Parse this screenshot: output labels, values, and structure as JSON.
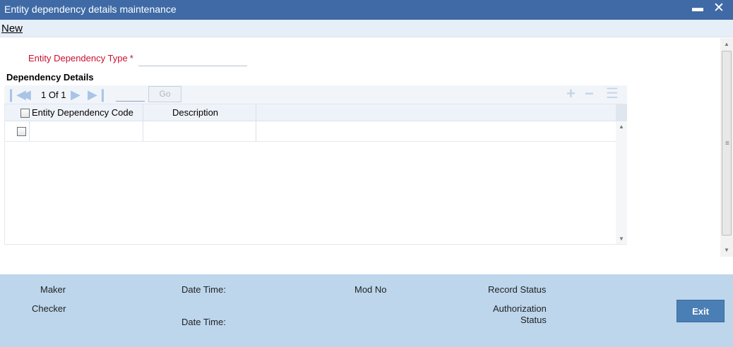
{
  "window": {
    "title": "Entity dependency details maintenance",
    "minimize_glyph": "▬",
    "close_glyph": "✕"
  },
  "menubar": {
    "new_label": "New"
  },
  "form": {
    "entity_dependency_type_label": "Entity Dependency Type",
    "required_mark": "*",
    "entity_dependency_type_value": ""
  },
  "section": {
    "title": "Dependency Details"
  },
  "pager": {
    "current": "1",
    "of_label": "Of",
    "total": "1",
    "go_label": "Go",
    "page_input_value": ""
  },
  "grid": {
    "columns": [
      "Entity Dependency Code",
      "Description"
    ],
    "rows": [
      {
        "code": "",
        "description": ""
      }
    ]
  },
  "footer": {
    "maker_label": "Maker",
    "checker_label": "Checker",
    "date_time_label_1": "Date Time:",
    "date_time_label_2": "Date Time:",
    "mod_no_label": "Mod No",
    "record_status_label": "Record Status",
    "authorization_label": "Authorization",
    "status_label": "Status",
    "exit_label": "Exit"
  },
  "colors": {
    "title_bar": "#3f6aa6",
    "required_label": "#c8102e",
    "footer_bg": "#bdd6ec",
    "exit_button": "#4a7fb5"
  },
  "icons": {
    "pager": [
      "first-page-icon",
      "previous-page-icon",
      "next-page-icon",
      "last-page-icon"
    ],
    "toolbar": [
      "add-row-icon",
      "delete-row-icon",
      "single-view-icon"
    ]
  }
}
